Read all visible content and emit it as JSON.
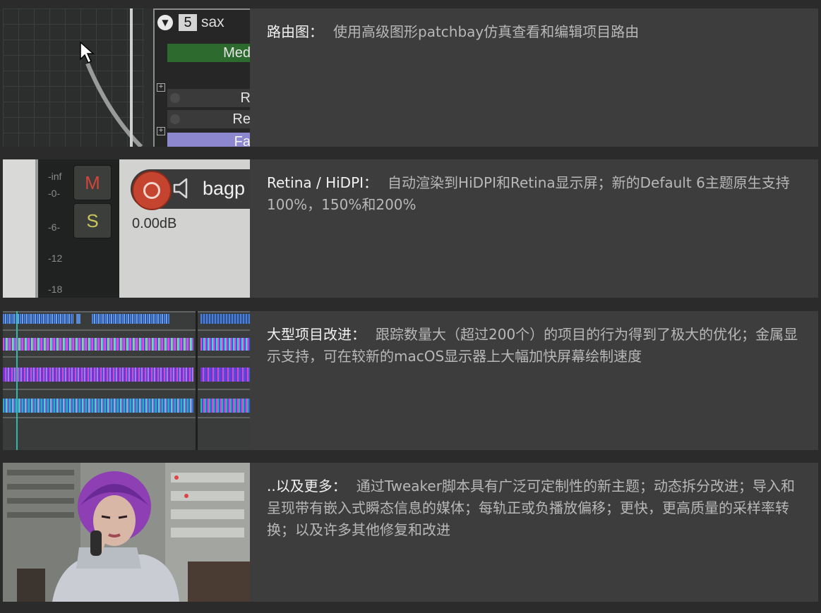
{
  "features": [
    {
      "title": "路由图：",
      "text": "使用高级图形patchbay仿真查看和编辑项目路由",
      "thumb": {
        "track_number": "5",
        "track_name": "sax",
        "rows": [
          "Med",
          "R",
          "Re",
          "Fa"
        ],
        "icon": "routing-patchbay"
      }
    },
    {
      "title": "Retina / HiDPI：",
      "text": "自动渲染到HiDPI和Retina显示屏；新的Default 6主题原生支持100%，150%和200%",
      "thumb": {
        "meter_labels": [
          "-inf",
          "-0-",
          "-6-",
          "-12",
          "-18"
        ],
        "mute_label": "M",
        "solo_label": "S",
        "track_name": "bagp",
        "volume": "0.00dB",
        "icon": "speaker-icon"
      }
    },
    {
      "title": "大型项目改进：",
      "text": "跟踪数量大（超过200个）的项目的行为得到了极大的优化；金属显示支持，可在较新的macOS显示器上大幅加快屏幕绘制速度",
      "thumb": {
        "icon": "waveform-arrange-view"
      }
    },
    {
      "title": "..以及更多：",
      "text": "通过Tweaker脚本具有广泛可定制性的新主题；动态拆分改进；导入和呈现带有嵌入式瞬态信息的媒体；每轨正或负播放偏移；更快，更高质量的采样率转换；以及许多其他修复和改进",
      "thumb": {
        "icon": "animated-photo"
      }
    }
  ],
  "colors": {
    "page_bg": "#2b2b2b",
    "row_bg": "#3d3d3d",
    "title": "#f2f2f2",
    "text": "#b8b8b8"
  }
}
